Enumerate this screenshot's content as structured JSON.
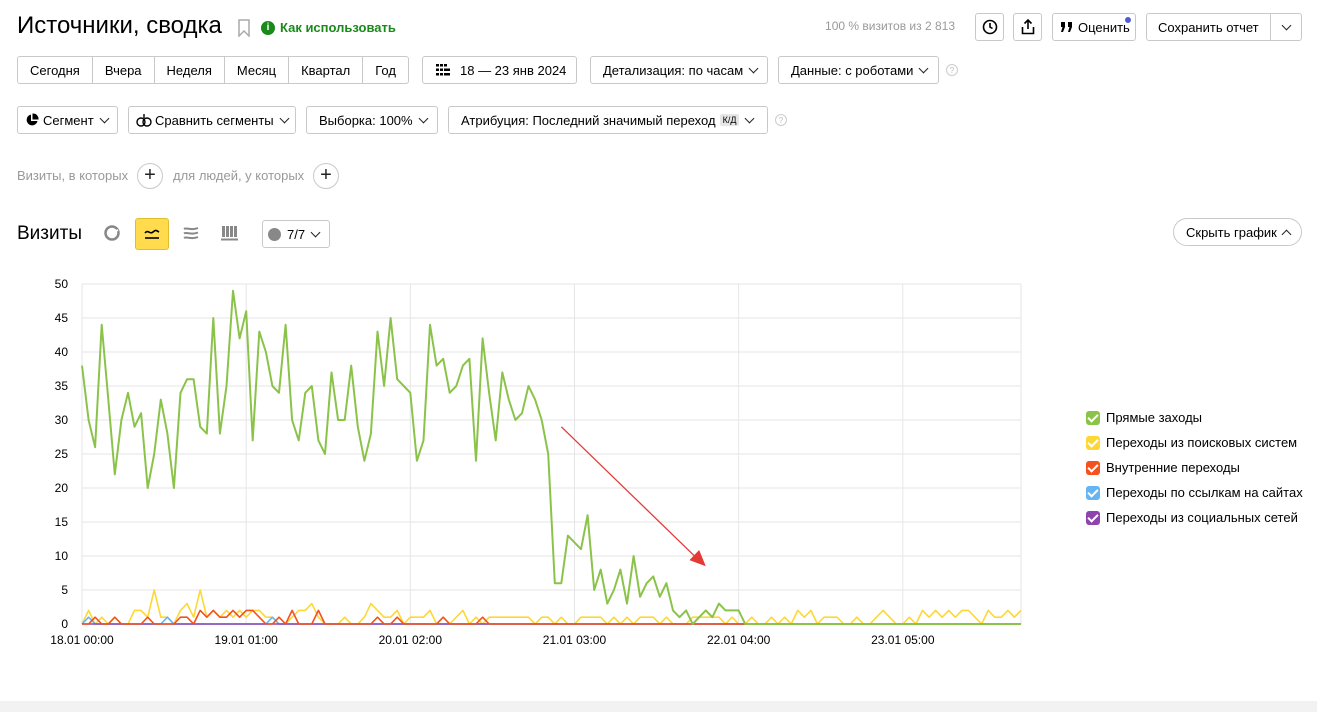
{
  "header": {
    "title": "Источники, сводка",
    "help_link": "Как использовать",
    "visits_info": "100 % визитов из 2 813",
    "rate_label": "Оценить",
    "save_report_label": "Сохранить отчет"
  },
  "periods": [
    "Сегодня",
    "Вчера",
    "Неделя",
    "Месяц",
    "Квартал",
    "Год"
  ],
  "date_range": "18 — 23 янв 2024",
  "detail_label": "Детализация: по часам",
  "data_label": "Данные: с роботами",
  "segment_label": "Сегмент",
  "compare_label": "Сравнить сегменты",
  "sample_label": "Выборка: 100%",
  "attribution_label": "Атрибуция: Последний значимый переход",
  "attribution_badge": "К/Д",
  "filters": {
    "visits_label": "Визиты, в которых",
    "people_label": "для людей, у которых"
  },
  "metric_title": "Визиты",
  "series_toggle": "7/7",
  "hide_chart_label": "Скрыть график",
  "colors": {
    "direct": "#8bc34a",
    "search": "#fdd835",
    "internal": "#f4511e",
    "links": "#64b5f6",
    "social": "#8e44ad",
    "accent": "#ffdb4d",
    "help_green": "#1a8a1a"
  },
  "chart_data": {
    "type": "line",
    "ylim": [
      0,
      50
    ],
    "y_ticks": [
      "0",
      "5",
      "10",
      "15",
      "20",
      "25",
      "30",
      "35",
      "40",
      "45",
      "50"
    ],
    "x_tick_labels": [
      "18.01 00:00",
      "19.01 01:00",
      "20.01 02:00",
      "21.01 03:00",
      "22.01 04:00",
      "23.01 05:00"
    ],
    "x_count": 144,
    "x_tick_index": [
      0,
      25,
      50,
      75,
      100,
      125
    ],
    "annotation": "arrow-down",
    "series": [
      {
        "name": "Прямые заходы",
        "color": "#8bc34a",
        "values": [
          38,
          30,
          26,
          44,
          33,
          22,
          30,
          34,
          29,
          31,
          20,
          25,
          33,
          28,
          20,
          34,
          36,
          36,
          29,
          28,
          45,
          28,
          35,
          49,
          42,
          46,
          27,
          43,
          40,
          35,
          34,
          44,
          30,
          27,
          34,
          35,
          27,
          25,
          37,
          30,
          30,
          38,
          29,
          24,
          28,
          43,
          35,
          45,
          36,
          35,
          34,
          24,
          27,
          44,
          38,
          39,
          34,
          35,
          38,
          39,
          24,
          42,
          34,
          27,
          37,
          33,
          30,
          31,
          35,
          33,
          30,
          25,
          6,
          6,
          13,
          12,
          11,
          16,
          5,
          8,
          3,
          5,
          8,
          3,
          10,
          4,
          6,
          7,
          4,
          6,
          2,
          1,
          2,
          0,
          1,
          2,
          1,
          3,
          2,
          2,
          2,
          0,
          0,
          0,
          0,
          0,
          0,
          0,
          0,
          0,
          0,
          0,
          0,
          0,
          0,
          0,
          0,
          0,
          0,
          0,
          0,
          0,
          0,
          0,
          0,
          0,
          0,
          0,
          0,
          0,
          0,
          0,
          0,
          0,
          0,
          0,
          0,
          0,
          0,
          0,
          0,
          0,
          0,
          0
        ]
      },
      {
        "name": "Переходы из поисковых систем",
        "color": "#fdd835",
        "values": [
          0,
          2,
          0,
          1,
          0,
          1,
          0,
          0,
          2,
          2,
          1,
          5,
          1,
          1,
          0,
          2,
          3,
          1,
          5,
          1,
          2,
          1,
          2,
          1,
          2,
          1,
          2,
          2,
          1,
          1,
          0,
          0,
          1,
          2,
          2,
          3,
          1,
          0,
          0,
          0,
          1,
          0,
          0,
          1,
          3,
          2,
          1,
          1,
          2,
          0,
          1,
          1,
          1,
          2,
          0,
          1,
          0,
          1,
          2,
          0,
          1,
          0,
          1,
          1,
          1,
          1,
          1,
          1,
          1,
          0,
          1,
          1,
          0,
          1,
          0,
          0,
          1,
          1,
          1,
          1,
          0,
          1,
          0,
          1,
          0,
          1,
          1,
          1,
          0,
          1,
          0,
          0,
          0,
          1,
          1,
          1,
          1,
          1,
          0,
          1,
          0,
          0,
          1,
          0,
          0,
          1,
          0,
          1,
          0,
          2,
          1,
          2,
          0,
          1,
          1,
          1,
          0,
          0,
          1,
          0,
          0,
          1,
          2,
          1,
          0,
          0,
          1,
          0,
          2,
          1,
          2,
          1,
          2,
          1,
          2,
          2,
          1,
          0,
          2,
          1,
          1,
          2,
          1,
          2
        ]
      },
      {
        "name": "Внутренние переходы",
        "color": "#f4511e",
        "values": [
          0,
          0,
          1,
          0,
          0,
          1,
          0,
          0,
          0,
          0,
          1,
          0,
          0,
          0,
          0,
          1,
          1,
          0,
          2,
          1,
          2,
          1,
          1,
          2,
          1,
          2,
          2,
          1,
          0,
          0,
          1,
          0,
          2,
          0,
          0,
          0,
          2,
          0,
          0,
          0,
          0,
          0,
          0,
          0,
          0,
          1,
          0,
          0,
          1,
          0,
          0,
          0,
          0,
          0,
          0,
          1,
          0,
          0,
          0,
          0,
          0,
          1,
          0,
          0,
          0,
          0,
          0,
          0,
          0,
          0,
          0,
          0,
          0,
          0,
          0,
          0,
          0,
          0,
          0,
          0,
          0,
          0,
          0,
          0,
          0,
          0,
          0,
          0,
          0,
          0,
          0,
          0,
          0,
          0,
          0,
          0,
          0,
          0,
          0,
          0,
          0,
          0,
          0,
          0,
          0,
          0,
          0,
          0,
          0,
          0,
          0,
          0,
          0,
          0,
          0,
          0,
          0,
          0,
          0,
          0,
          0,
          0,
          0,
          0,
          0,
          0,
          0,
          0,
          0,
          0,
          0,
          0,
          0,
          0,
          0,
          0,
          0,
          0,
          0,
          0,
          0,
          0,
          0,
          0
        ]
      },
      {
        "name": "Переходы по ссылкам на сайтах",
        "color": "#64b5f6",
        "values": [
          0,
          1,
          0,
          0,
          0,
          0,
          0,
          0,
          0,
          0,
          0,
          0,
          0,
          1,
          0,
          0,
          0,
          0,
          0,
          0,
          0,
          0,
          0,
          0,
          0,
          0,
          0,
          0,
          0,
          1,
          0,
          0,
          0,
          0,
          0,
          0,
          0,
          0,
          0,
          0,
          0,
          0,
          0,
          0,
          0,
          0,
          0,
          0,
          0,
          0,
          0,
          0,
          0,
          0,
          0,
          0,
          0,
          0,
          0,
          0,
          0,
          0,
          0,
          0,
          0,
          0,
          0,
          0,
          0,
          0,
          0,
          0,
          0,
          0,
          0,
          0,
          0,
          0,
          0,
          0,
          0,
          0,
          0,
          0,
          0,
          0,
          0,
          0,
          0,
          0,
          0,
          0,
          0,
          0,
          0,
          0,
          0,
          0,
          0,
          0,
          0,
          0,
          0,
          0,
          0,
          0,
          0,
          0,
          0,
          0,
          0,
          0,
          0,
          0,
          0,
          0,
          0,
          0,
          0,
          0,
          0,
          0,
          0,
          0,
          0,
          0,
          0,
          0,
          0,
          0,
          0,
          0,
          0,
          0,
          0,
          0,
          0,
          0,
          0,
          0,
          0,
          0,
          0,
          0
        ]
      },
      {
        "name": "Переходы из социальных сетей",
        "color": "#8e44ad",
        "values": [
          0,
          0,
          0,
          0,
          0,
          0,
          0,
          0,
          0,
          0,
          0,
          0,
          0,
          0,
          0,
          0,
          0,
          0,
          0,
          0,
          0,
          0,
          0,
          0,
          0,
          0,
          0,
          0,
          0,
          0,
          0,
          0,
          0,
          0,
          0,
          0,
          0,
          0,
          0,
          0,
          0,
          0,
          0,
          0,
          0,
          0,
          0,
          0,
          0,
          0,
          0,
          0,
          0,
          0,
          0,
          0,
          0,
          0,
          0,
          0,
          0,
          0,
          0,
          0,
          0,
          0,
          0,
          0,
          0,
          0,
          0,
          0,
          0,
          0,
          0,
          0,
          0,
          0,
          0,
          0,
          0,
          0,
          0,
          0,
          0,
          0,
          0,
          0,
          0,
          0,
          0,
          0,
          0,
          0,
          0,
          0,
          0,
          0,
          0,
          0,
          0,
          0,
          0,
          0,
          0,
          0,
          0,
          0,
          0,
          0,
          0,
          0,
          0,
          0,
          0,
          0,
          0,
          0,
          0,
          0,
          0,
          0,
          0,
          0,
          0,
          0,
          0,
          0,
          0,
          0,
          0,
          0,
          0,
          0,
          0,
          0,
          0,
          0,
          0,
          0,
          0,
          0,
          0,
          0
        ]
      }
    ]
  }
}
